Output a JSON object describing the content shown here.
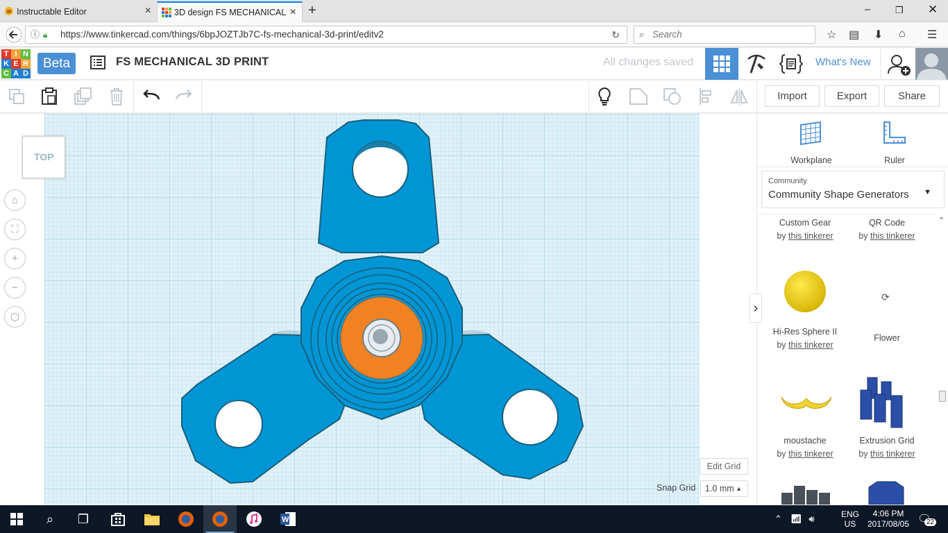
{
  "browser": {
    "tabs": [
      {
        "title": "Instructable Editor",
        "active": false
      },
      {
        "title": "3D design FS MECHANICAL",
        "active": true
      }
    ],
    "url": "https://www.tinkercad.com/things/6bpJOZTJb7C-fs-mechanical-3d-print/editv2",
    "search_placeholder": "Search"
  },
  "app": {
    "logo_letters": [
      "T",
      "I",
      "N",
      "K",
      "E",
      "R",
      "C",
      "A",
      "D"
    ],
    "logo_colors": [
      "#e2382a",
      "#f2a33a",
      "#5ebd3e",
      "#1f7fd1",
      "#e2382a",
      "#f2a33a",
      "#5ebd3e",
      "#1f7fd1",
      "#1f7fd1"
    ],
    "beta_label": "Beta",
    "design_title": "FS MECHANICAL 3D PRINT",
    "save_status": "All changes saved",
    "whats_new": "What's New"
  },
  "toolbar": {
    "import_label": "Import",
    "export_label": "Export",
    "share_label": "Share"
  },
  "viewport": {
    "viewcube_label": "TOP",
    "edit_grid_label": "Edit Grid",
    "snap_grid_label": "Snap Grid",
    "snap_grid_value": "1.0 mm"
  },
  "sidebar": {
    "workplane_label": "Workplane",
    "ruler_label": "Ruler",
    "category_small": "Community",
    "category_value": "Community Shape Generators",
    "by_prefix": "by",
    "shapes": [
      {
        "name": "Custom Gear",
        "author": "this tinkerer"
      },
      {
        "name": "QR Code",
        "author": "this tinkerer"
      },
      {
        "name": "Hi-Res Sphere II",
        "author": "this tinkerer"
      },
      {
        "name": "Flower",
        "author": ""
      },
      {
        "name": "moustache",
        "author": "this tinkerer"
      },
      {
        "name": "Extrusion Grid",
        "author": "this tinkerer"
      }
    ]
  },
  "taskbar": {
    "lang_top": "ENG",
    "lang_bottom": "US",
    "time": "4:06 PM",
    "date": "2017/08/05",
    "notification_count": "22"
  },
  "colors": {
    "spinner_blue": "#0096d6",
    "spinner_outline": "#1a5f7a",
    "bearing_orange": "#f08224",
    "accent_blue": "#4b8fd6",
    "grid_bg": "#dff1f8"
  }
}
